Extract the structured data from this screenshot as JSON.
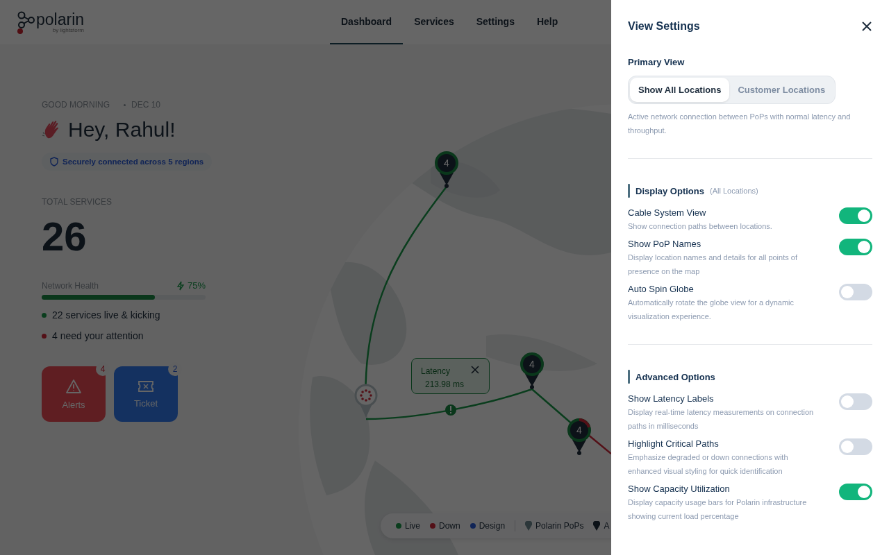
{
  "header": {
    "logo": "polarin",
    "logo_sub": "by lightstorm",
    "nav": [
      {
        "label": "Dashboard",
        "selected": true
      },
      {
        "label": "Services",
        "selected": false
      },
      {
        "label": "Settings",
        "selected": false
      },
      {
        "label": "Help",
        "selected": false
      }
    ]
  },
  "greeting": {
    "salutation": "GOOD MORNING",
    "date": "DEC 10",
    "title": "Hey, Rahul!",
    "secure_badge": "Securely connected across 5 regions"
  },
  "services": {
    "label": "TOTAL SERVICES",
    "total": "26",
    "health_label": "Network Health",
    "health_reading": "75%",
    "level": 0.69,
    "statuses": [
      {
        "text": "22 services live & kicking",
        "kind": "live"
      },
      {
        "text": "4 need your attention",
        "kind": "attention"
      }
    ]
  },
  "quick_actions": [
    {
      "kind": "alert",
      "label": "Alerts",
      "count": "4"
    },
    {
      "kind": "ticket",
      "label": "Ticket",
      "count": "2"
    }
  ],
  "map": {
    "pins": [
      {
        "kind": "count",
        "count": "4",
        "degraded": false
      },
      {
        "kind": "count",
        "count": "4",
        "degraded": false
      },
      {
        "kind": "count",
        "count": "4",
        "degraded": true
      },
      {
        "kind": "hub"
      }
    ],
    "latency_tooltip": {
      "title": "Latency",
      "value": "213.98 ms"
    },
    "legend": [
      {
        "kind": "live",
        "label": "Live"
      },
      {
        "kind": "down",
        "label": "Down"
      },
      {
        "kind": "design",
        "label": "Design"
      },
      {
        "kind": "pop",
        "label": "Polarin PoPs"
      },
      {
        "kind": "pin",
        "label": "A"
      }
    ]
  },
  "settings_panel": {
    "title": "View Settings",
    "primary_view": {
      "label": "Primary View",
      "options": [
        {
          "label": "Show All Locations",
          "selected": true
        },
        {
          "label": "Customer Locations",
          "selected": false
        }
      ],
      "description": "Active network connection between PoPs with normal latency and throughput."
    },
    "sections": [
      {
        "title": "Display Options",
        "qualifier": "(All Locations)",
        "options": [
          {
            "label": "Cable System View",
            "description": "Show connection paths between locations.",
            "on": true
          },
          {
            "label": "Show PoP Names",
            "description": "Display location names and details for all points of presence on the map",
            "on": true
          },
          {
            "label": "Auto Spin Globe",
            "description": "Automatically rotate the globe view for a dynamic visualization experience.",
            "on": false
          }
        ]
      },
      {
        "title": "Advanced Options",
        "options": [
          {
            "label": "Show Latency Labels",
            "description": "Display real-time latency measurements on connection paths in milliseconds",
            "on": false
          },
          {
            "label": "Highlight Critical Paths",
            "description": "Emphasize degraded or down connections with enhanced visual styling for quick identification",
            "on": false
          },
          {
            "label": "Show Capacity Utilization",
            "description": "Display capacity usage bars for Polarin infrastructure showing current load percentage",
            "on": true
          }
        ]
      }
    ]
  }
}
